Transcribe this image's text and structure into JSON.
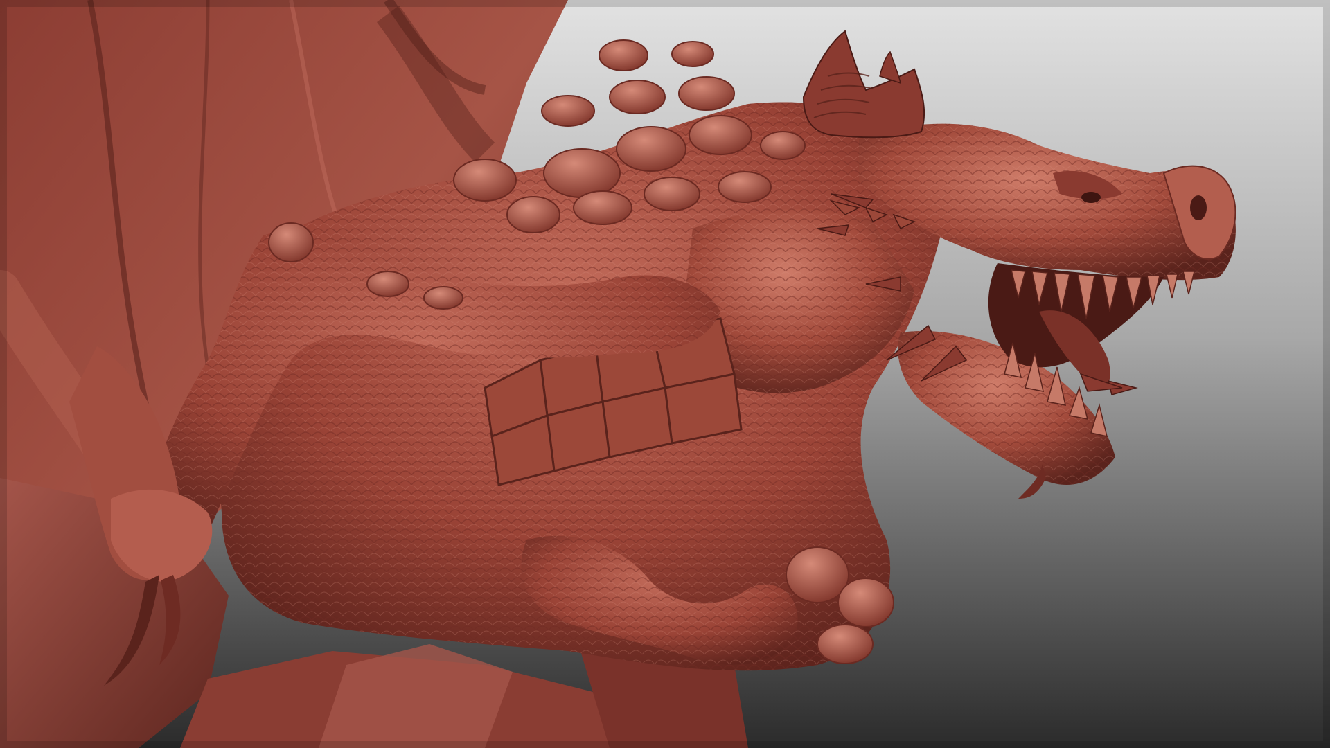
{
  "scene": {
    "subject": "dragon-sculpt",
    "material_colors": {
      "clay_base": "#9a4336",
      "clay_light": "#c06a5a",
      "clay_highlight": "#d98a78",
      "clay_shadow": "#6b2a22",
      "clay_deep": "#4a1a15",
      "background_top": "#dcdcdc",
      "background_bottom": "#2e2e2e"
    },
    "icons": [
      "dragon-head-icon",
      "horn-icon",
      "claw-icon",
      "wing-membrane-icon",
      "rock-base-icon"
    ]
  }
}
